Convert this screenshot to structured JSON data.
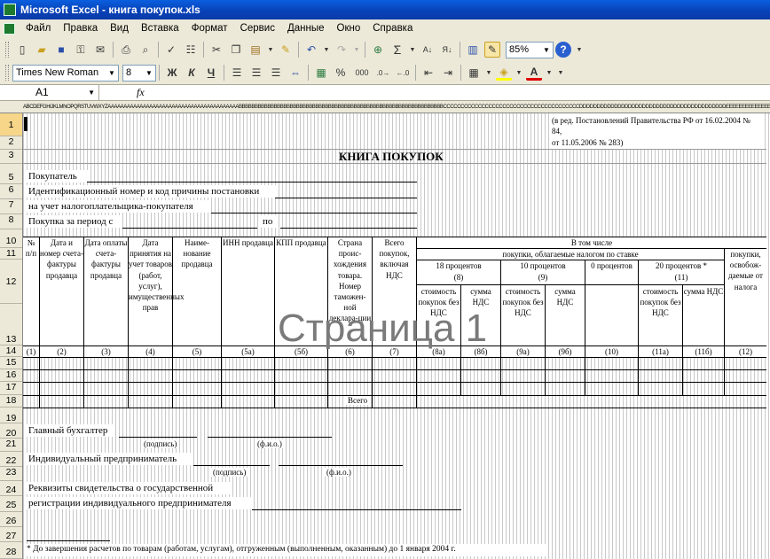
{
  "window": {
    "title": "Microsoft Excel - книга покупок.xls"
  },
  "menu": [
    "Файл",
    "Правка",
    "Вид",
    "Вставка",
    "Формат",
    "Сервис",
    "Данные",
    "Окно",
    "Справка"
  ],
  "toolbar": {
    "zoom": "85%",
    "font_name": "Times New Roman",
    "font_size": "8",
    "bold": "Ж",
    "italic": "К",
    "underline": "Ч",
    "percent": "%",
    "thousands": "000",
    "sigma": "Σ"
  },
  "formula_bar": {
    "cell_ref": "A1",
    "fx": "fx",
    "value": ""
  },
  "col_header_text": "ABCDEFGHIJKLMNOPQRSTUVWXYZAAAAAAAAAAAAAAAAAAAAAAAAAAAAAAAAAAAAAAAAABBBBBBBBBBBBBBBBBBBBBBBBBBBBBBBBBBBBBBBBBBBBBBBBBBBBBBBBBBBBBBBBCCCCCCCCCCCCCCCCCCCCCCCCCCCCCCCCCCCCCCCDDDDDDDDDDDDDDDDDDDDDDDDDDDDDDDDDDDDDDDDDDEEEEEEEEEEEEEEEEEEEEEEEEEEEEEEEEEEEEEEEEEEEEEEEEEEFFFFFFFFFFFFFFFFFFFFFFFFFFFFFFFFFFFFFFFFFF",
  "row_numbers": [
    "1",
    "2",
    "3",
    "5",
    "6",
    "7",
    "8",
    "10",
    "11",
    "12",
    "13",
    "14",
    "15",
    "16",
    "17",
    "18",
    "19",
    "20",
    "21",
    "22",
    "23",
    "24",
    "25",
    "26",
    "27",
    "28"
  ],
  "sheet": {
    "note_line1": "(в ред. Постановлений Правительства РФ от 16.02.2004 №",
    "note_line2": "84,",
    "note_line3": "от 11.05.2006 № 283)",
    "title": "КНИГА ПОКУПОК",
    "buyer": "Покупатель",
    "inn_line1": "Идентификационный номер и код причины постановки",
    "inn_line2": "на учет налогоплательщика-покупателя",
    "period": "Покупка за период с",
    "period_to": "по",
    "h_no": "№ п/п",
    "h_date_inv": "Дата и номер счета-фактуры продавца",
    "h_pay_date": "Дата оплаты счета-фактуры продавца",
    "h_accept": "Дата принятия на учет товаров (работ, услуг), имущественных прав",
    "h_seller": "Наиме-нование продавца",
    "h_inn": "ИНН продавца",
    "h_kpp": "КПП продавца",
    "h_country": "Страна проис-хождения товара. Номер таможен-ной деклара-ции",
    "h_total": "Всего покупок, включая НДС",
    "h_incl": "В том числе",
    "h_taxable": "покупки, облагаемые налогом по ставке",
    "h_exempt": "покупки, освобож-даемые от налога",
    "h_18": "18 процентов",
    "h_18n": "(8)",
    "h_10": "10 процентов",
    "h_10n": "(9)",
    "h_0": "0 процентов",
    "h_20": "20 процентов *",
    "h_20n": "(11)",
    "h_cost": "стоимость покупок без НДС",
    "h_vat": "сумма НДС",
    "colnums": [
      "(1)",
      "(2)",
      "(3)",
      "(4)",
      "(5)",
      "(5а)",
      "(5б)",
      "(6)",
      "(7)",
      "(8а)",
      "(8б)",
      "(9а)",
      "(9б)",
      "(10)",
      "(11а)",
      "(11б)",
      "(12)"
    ],
    "total": "Всего",
    "chief_acc": "Главный бухгалтер",
    "sign": "(подпись)",
    "fio": "(ф.и.о.)",
    "entrepreneur": "Индивидуальный предприниматель",
    "cert_line1": "Реквизиты свидетельства о государственной",
    "cert_line2": "регистрации индивидуального предпринимателя",
    "footnote": "* До завершения расчетов по товарам (работам, услугам), отгруженным (выполненным, оказанным) до 1 января 2004 г.",
    "watermark": "Страница 1"
  }
}
